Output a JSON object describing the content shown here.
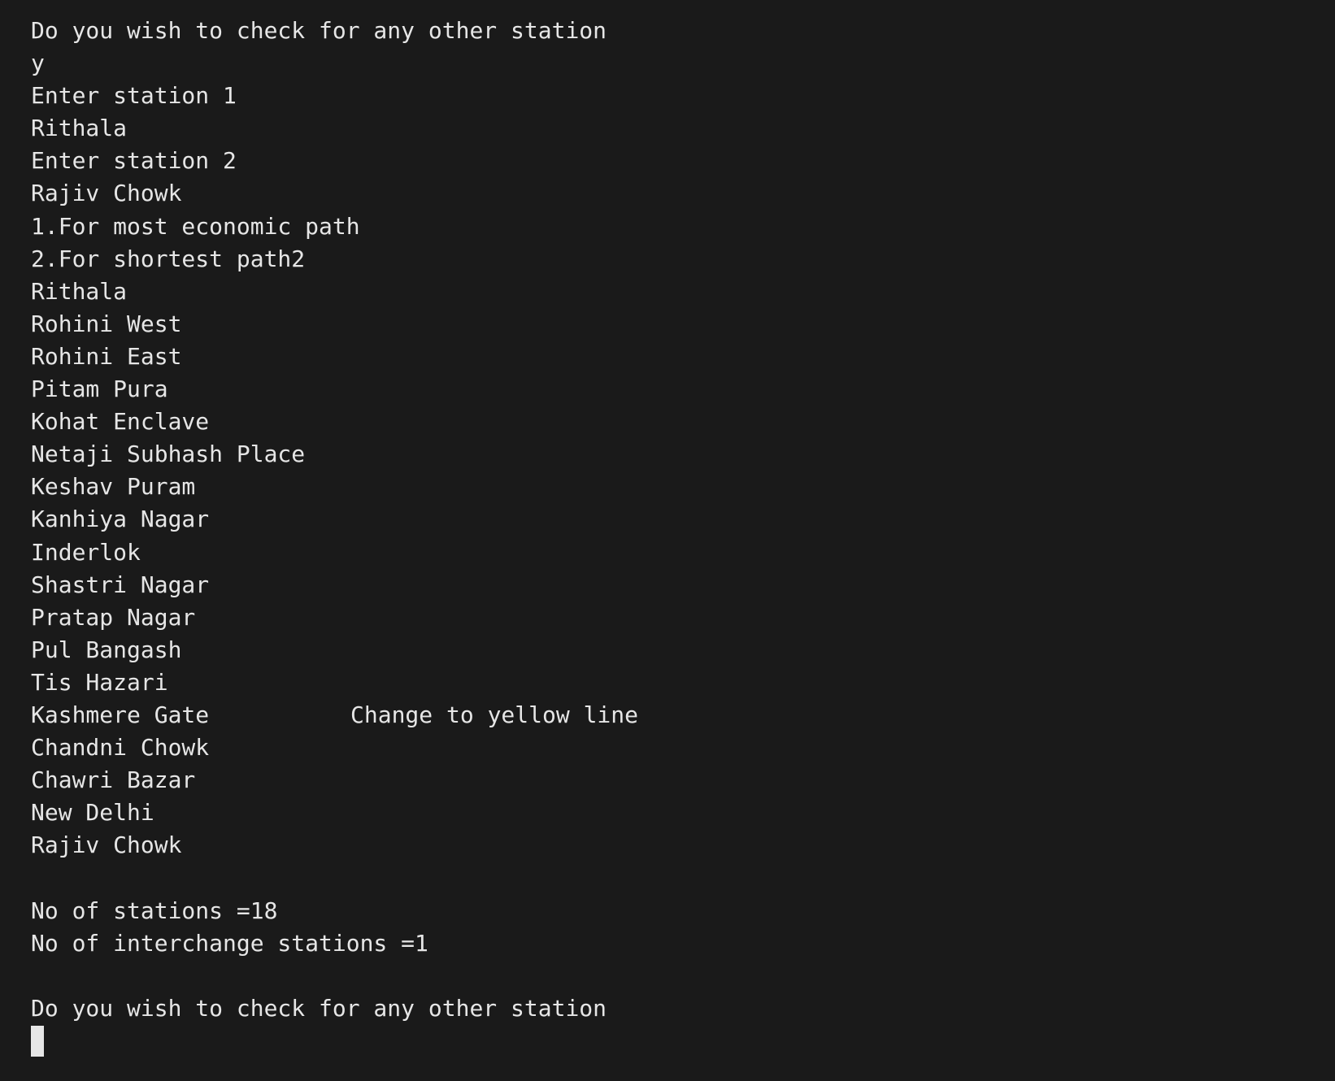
{
  "terminal": {
    "background": "#1a1a1a",
    "foreground": "#e6e6e6",
    "lines": [
      {
        "text": "Do you wish to check for any other station"
      },
      {
        "text": "y"
      },
      {
        "text": "Enter station 1"
      },
      {
        "text": "Rithala"
      },
      {
        "text": "Enter station 2"
      },
      {
        "text": "Rajiv Chowk"
      },
      {
        "text": "1.For most economic path"
      },
      {
        "text": "2.For shortest path2"
      },
      {
        "text": "Rithala"
      },
      {
        "text": "Rohini West"
      },
      {
        "text": "Rohini East"
      },
      {
        "text": "Pitam Pura"
      },
      {
        "text": "Kohat Enclave"
      },
      {
        "text": "Netaji Subhash Place"
      },
      {
        "text": "Keshav Puram"
      },
      {
        "text": "Kanhiya Nagar"
      },
      {
        "text": "Inderlok"
      },
      {
        "text": "Shastri Nagar"
      },
      {
        "text": "Pratap Nagar"
      },
      {
        "text": "Pul Bangash"
      },
      {
        "text": "Tis Hazari"
      },
      {
        "text": "Kashmere Gate",
        "note": "Change to yellow line"
      },
      {
        "text": "Chandni Chowk"
      },
      {
        "text": "Chawri Bazar"
      },
      {
        "text": "New Delhi"
      },
      {
        "text": "Rajiv Chowk"
      },
      {
        "text": ""
      },
      {
        "text": "No of stations =18"
      },
      {
        "text": "No of interchange stations =1"
      },
      {
        "text": ""
      },
      {
        "text": "Do you wish to check for any other station"
      }
    ]
  }
}
